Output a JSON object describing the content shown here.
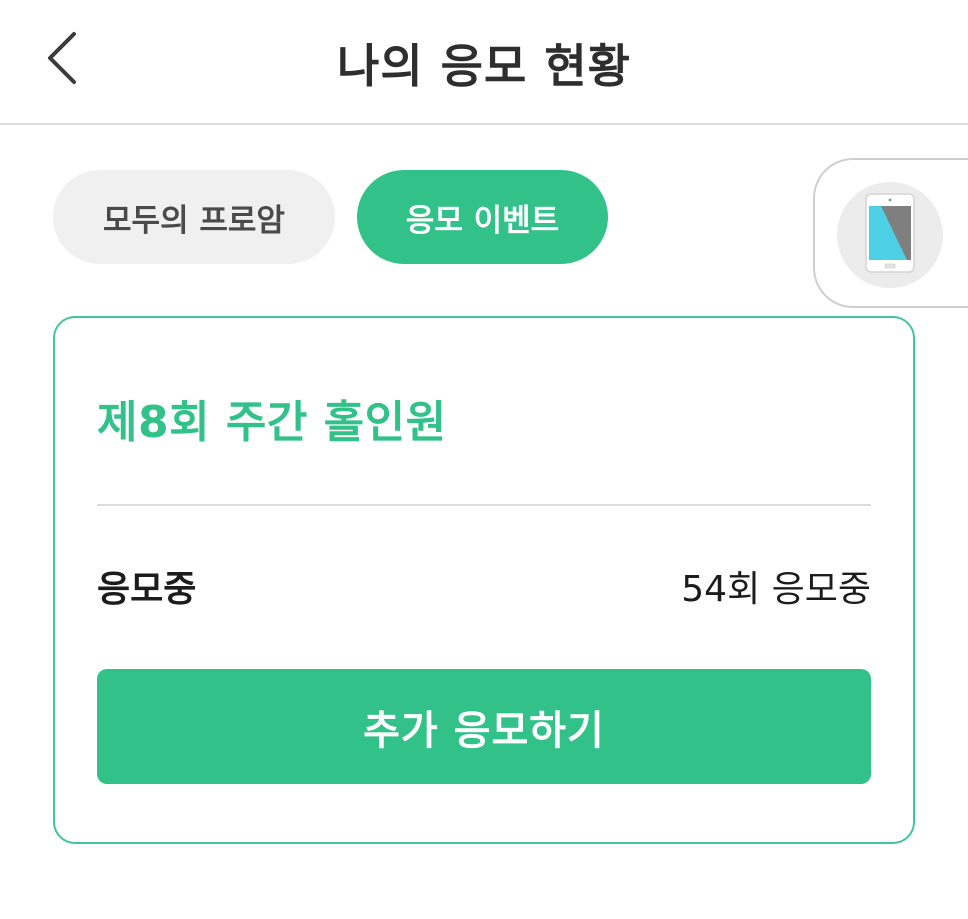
{
  "header": {
    "title": "나의 응모 현황",
    "back_icon": "chevron-left-icon"
  },
  "tabs": [
    {
      "label": "모두의 프로암",
      "active": false
    },
    {
      "label": "응모 이벤트",
      "active": true
    }
  ],
  "floating_widget": {
    "icon": "smartphone-icon"
  },
  "card": {
    "title": "제8회 주간 홀인원",
    "status_label": "응모중",
    "status_value": "54회 응모중",
    "button_label": "추가 응모하기"
  },
  "colors": {
    "accent": "#33c18a",
    "tab_inactive_bg": "#f0f0f0",
    "divider": "#dcdcdc"
  }
}
